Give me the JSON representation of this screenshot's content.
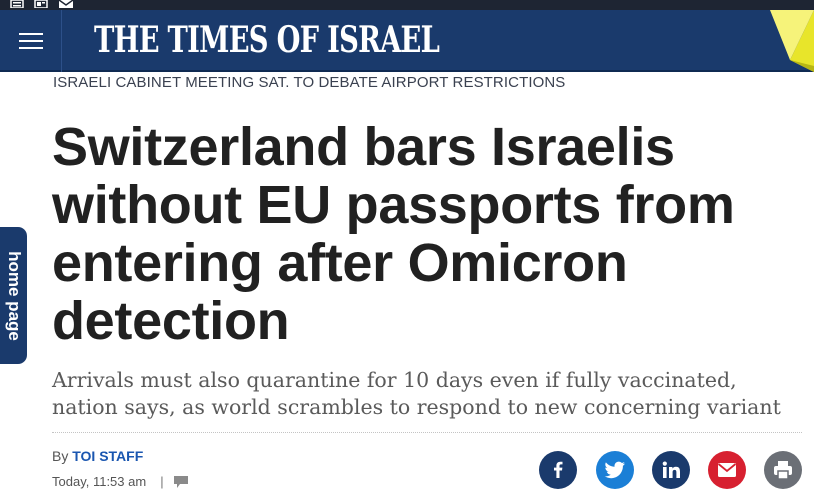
{
  "header": {
    "logo_text": "THE TIMES OF ISRAEL",
    "colors": {
      "navy": "#1a3a6c",
      "accent_yellow": "#e8e52a"
    }
  },
  "topbar": {
    "icons": [
      "newspaper-icon",
      "newsletter-icon",
      "mail-icon"
    ]
  },
  "home_tab": {
    "label": "home page"
  },
  "article": {
    "kicker": "ISRAELI CABINET MEETING SAT. TO DEBATE AIRPORT RESTRICTIONS",
    "headline": "Switzerland bars Israelis without EU passports from entering after Omicron detection",
    "subhead": "Arrivals must also quarantine for 10 days even if fully vaccinated, nation says, as world scrambles to respond to new concerning variant",
    "byline_prefix": "By",
    "author": "TOI STAFF",
    "date": "Today, 11:53 am",
    "separator": "|"
  },
  "share": {
    "buttons": [
      "facebook-icon",
      "twitter-icon",
      "linkedin-icon",
      "email-icon",
      "print-icon"
    ]
  }
}
